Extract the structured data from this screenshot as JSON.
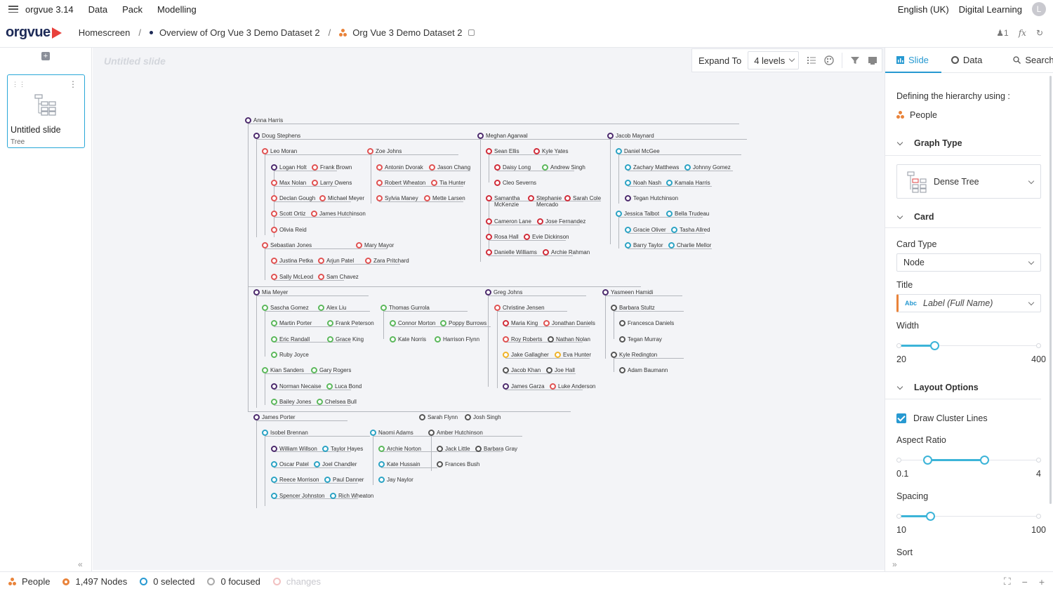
{
  "menubar": {
    "app_name": "orgvue 3.14",
    "items": [
      "Data",
      "Pack",
      "Modelling"
    ],
    "language": "English (UK)",
    "workspace": "Digital Learning",
    "avatar_initial": "L"
  },
  "brand": {
    "logo_text": "orgvue",
    "breadcrumbs": [
      "Homescreen",
      "Overview of Org Vue 3 Demo Dataset 2",
      "Org Vue 3 Demo Dataset 2"
    ],
    "user_count": "1"
  },
  "slides_panel": {
    "add_icon": "+",
    "slide": {
      "title": "Untitled slide",
      "type": "Tree"
    }
  },
  "canvas": {
    "slide_title": "Untitled slide",
    "toolbar": {
      "expand_label": "Expand To",
      "levels": "4 levels"
    }
  },
  "tree_nodes": [
    {
      "id": "n0",
      "name": "Anna Harris",
      "color": "#4c2a6d"
    },
    {
      "id": "n1",
      "name": "Doug Stephens",
      "color": "#4c2a6d"
    },
    {
      "id": "n2",
      "name": "Leo Moran",
      "color": "#e05252"
    },
    {
      "id": "n3",
      "name": "Logan Holt",
      "color": "#4c2a6d"
    },
    {
      "id": "n4",
      "name": "Frank Brown",
      "color": "#e05252"
    },
    {
      "id": "n5",
      "name": "Max Nolan",
      "color": "#e05252"
    },
    {
      "id": "n6",
      "name": "Larry Owens",
      "color": "#e05252"
    },
    {
      "id": "n7",
      "name": "Declan Gough",
      "color": "#e05252"
    },
    {
      "id": "n8",
      "name": "Michael Meyer",
      "color": "#e05252"
    },
    {
      "id": "n9",
      "name": "Scott Ortiz",
      "color": "#e05252"
    },
    {
      "id": "n10",
      "name": "James Hutchinson",
      "color": "#e05252"
    },
    {
      "id": "n11",
      "name": "Olivia Reid",
      "color": "#e05252"
    },
    {
      "id": "n12",
      "name": "Zoe Johns",
      "color": "#e05252"
    },
    {
      "id": "n13",
      "name": "Antonin Dvorak",
      "color": "#e05252"
    },
    {
      "id": "n14",
      "name": "Jason Chang",
      "color": "#e05252"
    },
    {
      "id": "n15",
      "name": "Robert Wheaton",
      "color": "#e05252"
    },
    {
      "id": "n16",
      "name": "Tia Hunter",
      "color": "#e05252"
    },
    {
      "id": "n17",
      "name": "Sylvia Maney",
      "color": "#e05252"
    },
    {
      "id": "n18",
      "name": "Mette Larsen",
      "color": "#e05252"
    },
    {
      "id": "n19",
      "name": "Sebastian Jones",
      "color": "#e05252"
    },
    {
      "id": "n20",
      "name": "Mary Mayor",
      "color": "#e05252"
    },
    {
      "id": "n21",
      "name": "Justina Petka",
      "color": "#e05252"
    },
    {
      "id": "n22",
      "name": "Arjun Patel",
      "color": "#e05252"
    },
    {
      "id": "n23",
      "name": "Zara Pritchard",
      "color": "#e05252"
    },
    {
      "id": "n24",
      "name": "Sally McLeod",
      "color": "#e05252"
    },
    {
      "id": "n25",
      "name": "Sam Chavez",
      "color": "#e05252"
    },
    {
      "id": "n26",
      "name": "Meghan Agarwal",
      "color": "#4c2a6d"
    },
    {
      "id": "n27",
      "name": "Sean Ellis",
      "color": "#d12d3a"
    },
    {
      "id": "n28",
      "name": "Kyle Yates",
      "color": "#d12d3a"
    },
    {
      "id": "n29",
      "name": "Daisy Long",
      "color": "#d12d3a"
    },
    {
      "id": "n30",
      "name": "Andrew Singh",
      "color": "#5cb85c"
    },
    {
      "id": "n31",
      "name": "Cleo Severns",
      "color": "#d12d3a"
    },
    {
      "id": "n32",
      "name": "Samantha McKenzie",
      "color": "#d12d3a"
    },
    {
      "id": "n33",
      "name": "Stephanie Mercado",
      "color": "#d12d3a"
    },
    {
      "id": "n34",
      "name": "Sarah Cole",
      "color": "#d12d3a"
    },
    {
      "id": "n35",
      "name": "Cameron Lane",
      "color": "#d12d3a"
    },
    {
      "id": "n36",
      "name": "Jose Fernandez",
      "color": "#d12d3a"
    },
    {
      "id": "n37",
      "name": "Rosa Hall",
      "color": "#d12d3a"
    },
    {
      "id": "n38",
      "name": "Evie Dickinson",
      "color": "#d12d3a"
    },
    {
      "id": "n39",
      "name": "Danielle Williams",
      "color": "#d12d3a"
    },
    {
      "id": "n40",
      "name": "Archie Rahman",
      "color": "#d12d3a"
    },
    {
      "id": "n41",
      "name": "Jacob Maynard",
      "color": "#4c2a6d"
    },
    {
      "id": "n42",
      "name": "Daniel McGee",
      "color": "#2ba3c4"
    },
    {
      "id": "n43",
      "name": "Zachary Matthews",
      "color": "#2ba3c4"
    },
    {
      "id": "n44",
      "name": "Johnny Gomez",
      "color": "#2ba3c4"
    },
    {
      "id": "n45",
      "name": "Noah Nash",
      "color": "#2ba3c4"
    },
    {
      "id": "n46",
      "name": "Kamala Harris",
      "color": "#2ba3c4"
    },
    {
      "id": "n47",
      "name": "Tegan Hutchinson",
      "color": "#4c2a6d"
    },
    {
      "id": "n48",
      "name": "Jessica Talbot",
      "color": "#2ba3c4"
    },
    {
      "id": "n49",
      "name": "Bella Trudeau",
      "color": "#2ba3c4"
    },
    {
      "id": "n50",
      "name": "Gracie Oliver",
      "color": "#2ba3c4"
    },
    {
      "id": "n51",
      "name": "Tasha Allred",
      "color": "#2ba3c4"
    },
    {
      "id": "n52",
      "name": "Barry Taylor",
      "color": "#2ba3c4"
    },
    {
      "id": "n53",
      "name": "Charlie Mellor",
      "color": "#2ba3c4"
    },
    {
      "id": "n54",
      "name": "Mia Meyer",
      "color": "#4c2a6d"
    },
    {
      "id": "n55",
      "name": "Sascha Gomez",
      "color": "#5cb85c"
    },
    {
      "id": "n56",
      "name": "Alex Liu",
      "color": "#5cb85c"
    },
    {
      "id": "n57",
      "name": "Martin Porter",
      "color": "#5cb85c"
    },
    {
      "id": "n58",
      "name": "Frank Peterson",
      "color": "#5cb85c"
    },
    {
      "id": "n59",
      "name": "Eric Randall",
      "color": "#5cb85c"
    },
    {
      "id": "n60",
      "name": "Grace King",
      "color": "#5cb85c"
    },
    {
      "id": "n61",
      "name": "Ruby Joyce",
      "color": "#5cb85c"
    },
    {
      "id": "n62",
      "name": "Thomas Gurrola",
      "color": "#5cb85c"
    },
    {
      "id": "n63",
      "name": "Connor Morton",
      "color": "#5cb85c"
    },
    {
      "id": "n64",
      "name": "Poppy Burrows",
      "color": "#5cb85c"
    },
    {
      "id": "n65",
      "name": "Kate Norris",
      "color": "#5cb85c"
    },
    {
      "id": "n66",
      "name": "Harrison Flynn",
      "color": "#5cb85c"
    },
    {
      "id": "n67",
      "name": "Kian Sanders",
      "color": "#5cb85c"
    },
    {
      "id": "n68",
      "name": "Gary Rogers",
      "color": "#5cb85c"
    },
    {
      "id": "n69",
      "name": "Norman Necaise",
      "color": "#4c2a6d"
    },
    {
      "id": "n70",
      "name": "Luca Bond",
      "color": "#5cb85c"
    },
    {
      "id": "n71",
      "name": "Bailey Jones",
      "color": "#5cb85c"
    },
    {
      "id": "n72",
      "name": "Chelsea Bull",
      "color": "#5cb85c"
    },
    {
      "id": "n73",
      "name": "Greg Johns",
      "color": "#4c2a6d"
    },
    {
      "id": "n74",
      "name": "Christine Jensen",
      "color": "#e05252"
    },
    {
      "id": "n75",
      "name": "Maria King",
      "color": "#d12d3a"
    },
    {
      "id": "n76",
      "name": "Jonathan Daniels",
      "color": "#e05252"
    },
    {
      "id": "n77",
      "name": "Roy Roberts",
      "color": "#e05252"
    },
    {
      "id": "n78",
      "name": "Nathan Nolan",
      "color": "#555555"
    },
    {
      "id": "n79",
      "name": "Jake Gallagher",
      "color": "#f0b429"
    },
    {
      "id": "n80",
      "name": "Eva Hunter",
      "color": "#f0b429"
    },
    {
      "id": "n81",
      "name": "Jacob Khan",
      "color": "#555555"
    },
    {
      "id": "n82",
      "name": "Joe Hall",
      "color": "#555555"
    },
    {
      "id": "n83",
      "name": "James Garza",
      "color": "#4c2a6d"
    },
    {
      "id": "n84",
      "name": "Luke Anderson",
      "color": "#e05252"
    },
    {
      "id": "n85",
      "name": "Yasmeen Hamidi",
      "color": "#4c2a6d"
    },
    {
      "id": "n86",
      "name": "Barbara Stultz",
      "color": "#555555"
    },
    {
      "id": "n87",
      "name": "Francesca Daniels",
      "color": "#555555"
    },
    {
      "id": "n88",
      "name": "Tegan Murray",
      "color": "#555555"
    },
    {
      "id": "n89",
      "name": "Kyle Redington",
      "color": "#555555"
    },
    {
      "id": "n90",
      "name": "Adam Baumann",
      "color": "#555555"
    },
    {
      "id": "n91",
      "name": "James Porter",
      "color": "#4c2a6d"
    },
    {
      "id": "n92",
      "name": "Isobel Brennan",
      "color": "#2ba3c4"
    },
    {
      "id": "n93",
      "name": "William Willson",
      "color": "#4c2a6d"
    },
    {
      "id": "n94",
      "name": "Taylor Hayes",
      "color": "#2ba3c4"
    },
    {
      "id": "n95",
      "name": "Oscar Patel",
      "color": "#2ba3c4"
    },
    {
      "id": "n96",
      "name": "Joel Chandler",
      "color": "#2ba3c4"
    },
    {
      "id": "n97",
      "name": "Reece Morrison",
      "color": "#2ba3c4"
    },
    {
      "id": "n98",
      "name": "Paul Danner",
      "color": "#2ba3c4"
    },
    {
      "id": "n99",
      "name": "Spencer Johnston",
      "color": "#2ba3c4"
    },
    {
      "id": "n100",
      "name": "Rich Wheaton",
      "color": "#2ba3c4"
    },
    {
      "id": "n101",
      "name": "Naomi Adams",
      "color": "#2ba3c4"
    },
    {
      "id": "n102",
      "name": "Archie Norton",
      "color": "#5cb85c"
    },
    {
      "id": "n103",
      "name": "Kate Hussain",
      "color": "#2ba3c4"
    },
    {
      "id": "n104",
      "name": "Jay Naylor",
      "color": "#2ba3c4"
    },
    {
      "id": "n105",
      "name": "Sarah Flynn",
      "color": "#555555"
    },
    {
      "id": "n106",
      "name": "Josh Singh",
      "color": "#555555"
    },
    {
      "id": "n107",
      "name": "Amber Hutchinson",
      "color": "#555555"
    },
    {
      "id": "n108",
      "name": "Jack Little",
      "color": "#555555"
    },
    {
      "id": "n109",
      "name": "Barbara Gray",
      "color": "#555555"
    },
    {
      "id": "n110",
      "name": "Frances Bush",
      "color": "#555555"
    }
  ],
  "right_panel": {
    "tabs": [
      "Slide",
      "Data",
      "Search"
    ],
    "hierarchy_label": "Defining the hierarchy using :",
    "hierarchy_value": "People",
    "graph_type_header": "Graph Type",
    "graph_type_value": "Dense Tree",
    "card_header": "Card",
    "card_type_label": "Card Type",
    "card_type_value": "Node",
    "title_label": "Title",
    "title_badge": "Abc",
    "title_value": "Label (Full Name)",
    "width_label": "Width",
    "width_min": "20",
    "width_max": "400",
    "width_level": 0.25,
    "layout_header": "Layout Options",
    "draw_cluster_lines": "Draw Cluster Lines",
    "draw_cluster_lines_checked": true,
    "aspect_label": "Aspect Ratio",
    "aspect_min": "0.1",
    "aspect_max": "4",
    "aspect_low": 0.2,
    "aspect_high": 0.61,
    "spacing_label": "Spacing",
    "spacing_min": "10",
    "spacing_max": "100",
    "spacing_level": 0.22,
    "sort_label": "Sort",
    "accent_color": "#2799d1"
  },
  "statusbar": {
    "dataset": "People",
    "nodes": "1,497 Nodes",
    "selected": "0 selected",
    "focused": "0 focused",
    "changes": "changes"
  }
}
